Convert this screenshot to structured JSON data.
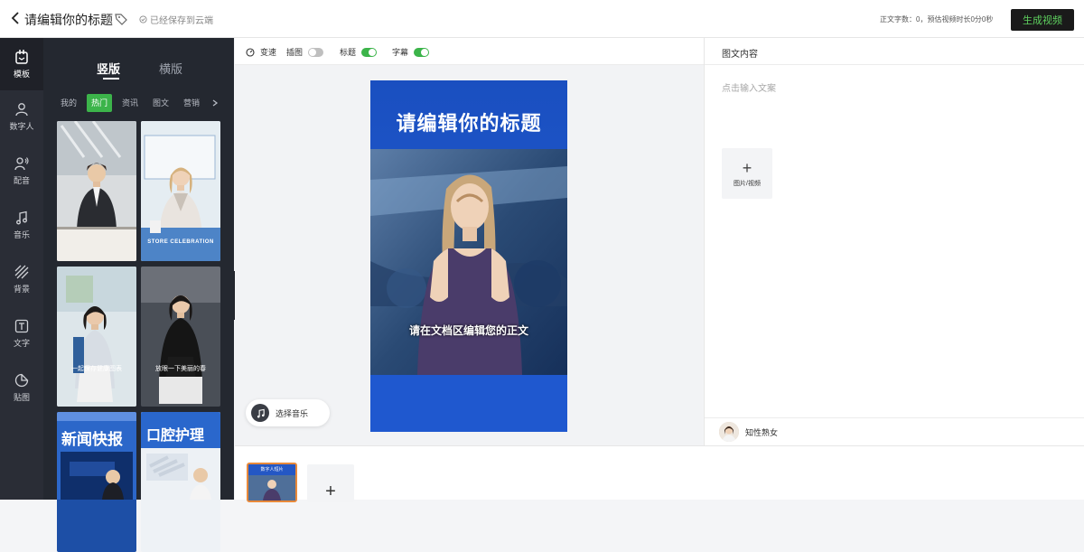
{
  "header": {
    "title": "请编辑你的标题",
    "saved_status": "已经保存到云端",
    "word_count": "正文字数：0，预估视频时长0分0秒",
    "generate_label": "生成视频"
  },
  "rail": {
    "items": [
      {
        "label": "模板",
        "icon": "template-icon"
      },
      {
        "label": "数字人",
        "icon": "person-icon"
      },
      {
        "label": "配音",
        "icon": "voice-icon"
      },
      {
        "label": "音乐",
        "icon": "music-note-icon"
      },
      {
        "label": "背景",
        "icon": "background-icon"
      },
      {
        "label": "文字",
        "icon": "text-icon"
      },
      {
        "label": "贴图",
        "icon": "sticker-icon"
      }
    ]
  },
  "templates": {
    "orientation_tabs": [
      "竖版",
      "横版"
    ],
    "categories": [
      "我的",
      "热门",
      "资讯",
      "图文",
      "营销"
    ],
    "selected_category": "热门",
    "thumbs": [
      {
        "caption": ""
      },
      {
        "caption": "STORE CELEBRATION"
      },
      {
        "caption": "一起保存健康图表"
      },
      {
        "caption": "放眼一下美丽的春"
      },
      {
        "caption": "新闻快报"
      },
      {
        "caption": "口腔护理"
      }
    ]
  },
  "toolbar": {
    "speed_label": "变速",
    "insert_label": "插图",
    "title_label": "标题",
    "subtitle_label": "字幕",
    "insert_on": false,
    "title_on": true,
    "subtitle_on": true
  },
  "preview": {
    "title": "请编辑你的标题",
    "subtitle": "请在文档区编辑您的正文",
    "music_label": "选择音乐"
  },
  "content_panel": {
    "header": "图文内容",
    "placeholder": "点击输入文案",
    "add_media_label": "图片/视频",
    "voice_label": "知性熟女"
  },
  "scenes": {
    "first_caption": "数字人短片"
  },
  "colors": {
    "accent_green": "#3cb44a",
    "dark_panel": "#242830",
    "rail_bg": "#2a2d36",
    "selected_scene_border": "#e8893a"
  }
}
